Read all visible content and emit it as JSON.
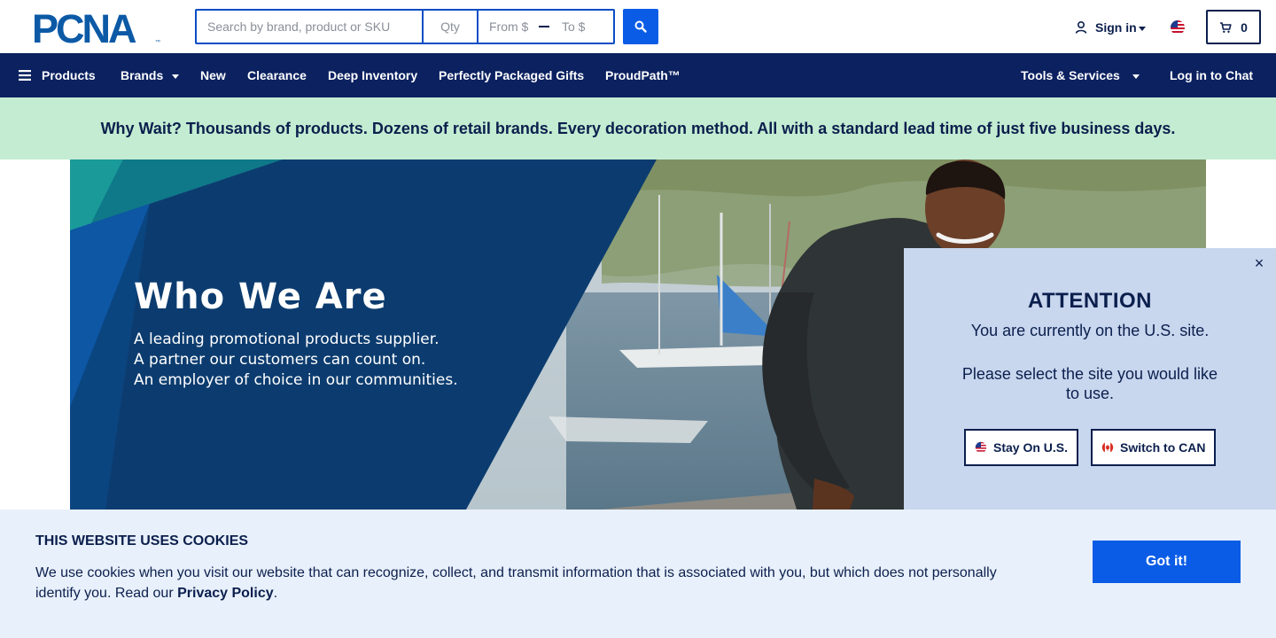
{
  "header": {
    "logo_text": "PCNA",
    "search_placeholder": "Search by brand, product or SKU",
    "qty_placeholder": "Qty",
    "from_placeholder": "From $",
    "to_placeholder": "To $",
    "signin_label": "Sign in",
    "cart_count": "0"
  },
  "nav": {
    "products": "Products",
    "brands": "Brands",
    "new": "New",
    "clearance": "Clearance",
    "deep_inventory": "Deep Inventory",
    "gifts": "Perfectly Packaged Gifts",
    "proudpath": "ProudPath™",
    "tools": "Tools & Services",
    "chat": "Log in to Chat"
  },
  "promo": {
    "text": "Why Wait? Thousands of products. Dozens of retail brands. Every decoration method. All with a standard lead time of just five business days."
  },
  "hero": {
    "title": "Who We Are",
    "lines": [
      "A leading promotional products supplier.",
      "A partner our customers can count on.",
      "An employer of choice in our communities."
    ]
  },
  "modal": {
    "close": "×",
    "title": "ATTENTION",
    "message": "You are currently on the U.S. site.",
    "ask": "Please select the site you would like to use.",
    "stay_label": "Stay On U.S.",
    "switch_label": "Switch to CAN"
  },
  "cookie": {
    "title": "THIS WEBSITE USES COOKIES",
    "text": "We use cookies when you visit our website that can recognize, collect, and transmit information that is associated with you, but which does not personally identify you. Read our ",
    "link": "Privacy Policy",
    "end": ".",
    "button": "Got it!"
  },
  "colors": {
    "navy": "#0b2160",
    "accent_blue": "#0a5ce6",
    "promo_green": "#c4ecd2",
    "modal_bg": "#c8d6ee",
    "cookie_bg": "#e8f0fb"
  },
  "icons": [
    "menu-icon",
    "search-icon",
    "user-icon",
    "us-flag-icon",
    "canada-flag-icon",
    "cart-icon",
    "close-icon",
    "chevron-down-icon"
  ]
}
